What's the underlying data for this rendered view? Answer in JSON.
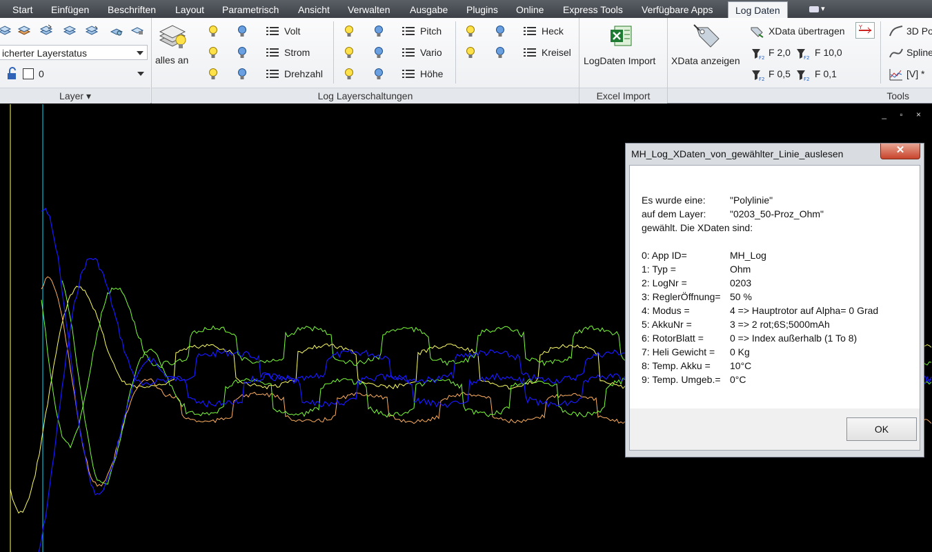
{
  "tabs": [
    {
      "label": "Start"
    },
    {
      "label": "Einfügen"
    },
    {
      "label": "Beschriften"
    },
    {
      "label": "Layout"
    },
    {
      "label": "Parametrisch"
    },
    {
      "label": "Ansicht"
    },
    {
      "label": "Verwalten"
    },
    {
      "label": "Ausgabe"
    },
    {
      "label": "Plugins"
    },
    {
      "label": "Online"
    },
    {
      "label": "Express Tools"
    },
    {
      "label": "Verfügbare Apps"
    },
    {
      "label": "Log Daten"
    }
  ],
  "tab_extra": "▾",
  "layer_panel": {
    "layerstate_combo": "icherter Layerstatus",
    "layer_combo": "0",
    "footer": "Layer ▾"
  },
  "log_layer": {
    "alles_an": "alles an",
    "items": [
      "Volt",
      "Strom",
      "Drehzahl",
      "Pitch",
      "Vario",
      "Höhe",
      "Heck",
      "Kreisel"
    ],
    "footer": "Log Layerschaltungen"
  },
  "excel": {
    "button": "LogDaten Import",
    "footer": "Excel Import"
  },
  "tools": {
    "xdata_anzeigen": "XData anzeigen",
    "xdata_uebertragen": "XData übertragen",
    "f_buttons": [
      "F 2,0",
      "F 10,0",
      "F 0,5",
      "F 0,1"
    ],
    "right_items": [
      "3D Po",
      "Spline",
      "[V] *"
    ],
    "footer": "Tools"
  },
  "window_controls": "_ ▫ ×",
  "dialog": {
    "title": "MH_Log_XDaten_von_gewählter_Linie_auslesen",
    "close": "✕",
    "intro": [
      {
        "k": "Es wurde eine:",
        "v": "\"Polylinie\""
      },
      {
        "k": "auf dem Layer:",
        "v": "\"0203_50-Proz_Ohm\""
      },
      {
        "k": "gewählt. Die XDaten sind:",
        "v": ""
      }
    ],
    "rows": [
      {
        "k": "0: App ID=",
        "v": "MH_Log"
      },
      {
        "k": "1: Typ =",
        "v": "Ohm"
      },
      {
        "k": "2: LogNr =",
        "v": "0203"
      },
      {
        "k": "3: ReglerÖffnung=",
        "v": "50 %"
      },
      {
        "k": "4: Modus =",
        "v": "4 => Hauptrotor auf Alpha= 0 Grad"
      },
      {
        "k": "5: AkkuNr =",
        "v": "3 => 2 rot;6S;5000mAh"
      },
      {
        "k": "6: RotorBlatt =",
        "v": "0 => Index außerhalb (1 To 8)"
      },
      {
        "k": "7: Heli Gewicht =",
        "v": "0 Kg"
      },
      {
        "k": "8: Temp. Akku =",
        "v": "10°C"
      },
      {
        "k": "9: Temp. Umgeb.=",
        "v": "0°C"
      }
    ],
    "ok": "OK"
  },
  "colors": {
    "yellow": "#ffff66",
    "green": "#7cff3a",
    "blue": "#1818ff",
    "orange": "#ffb060",
    "cyan": "#00e0ff"
  }
}
